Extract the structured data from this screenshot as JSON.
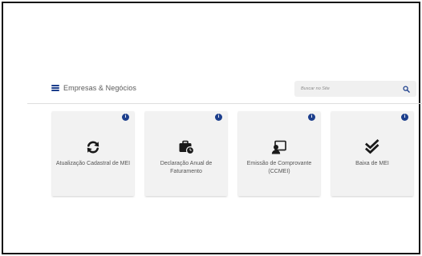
{
  "header": {
    "menu_label": "Empresas & Negócios",
    "search_placeholder": "Buscar no Site"
  },
  "colors": {
    "accent": "#1c3e8c",
    "card_bg": "#f2f2f2",
    "text": "#555555"
  },
  "cards": [
    {
      "label": "Atualização Cadastral de MEI",
      "icon": "sync-icon",
      "info": "i"
    },
    {
      "label": "Declaração Anual de Faturamento",
      "icon": "briefcase-clock-icon",
      "info": "i"
    },
    {
      "label": "Emissão de Comprovante (CCMEI)",
      "icon": "certificate-user-icon",
      "info": "i"
    },
    {
      "label": "Baixa de MEI",
      "icon": "double-check-icon",
      "info": "i"
    }
  ]
}
